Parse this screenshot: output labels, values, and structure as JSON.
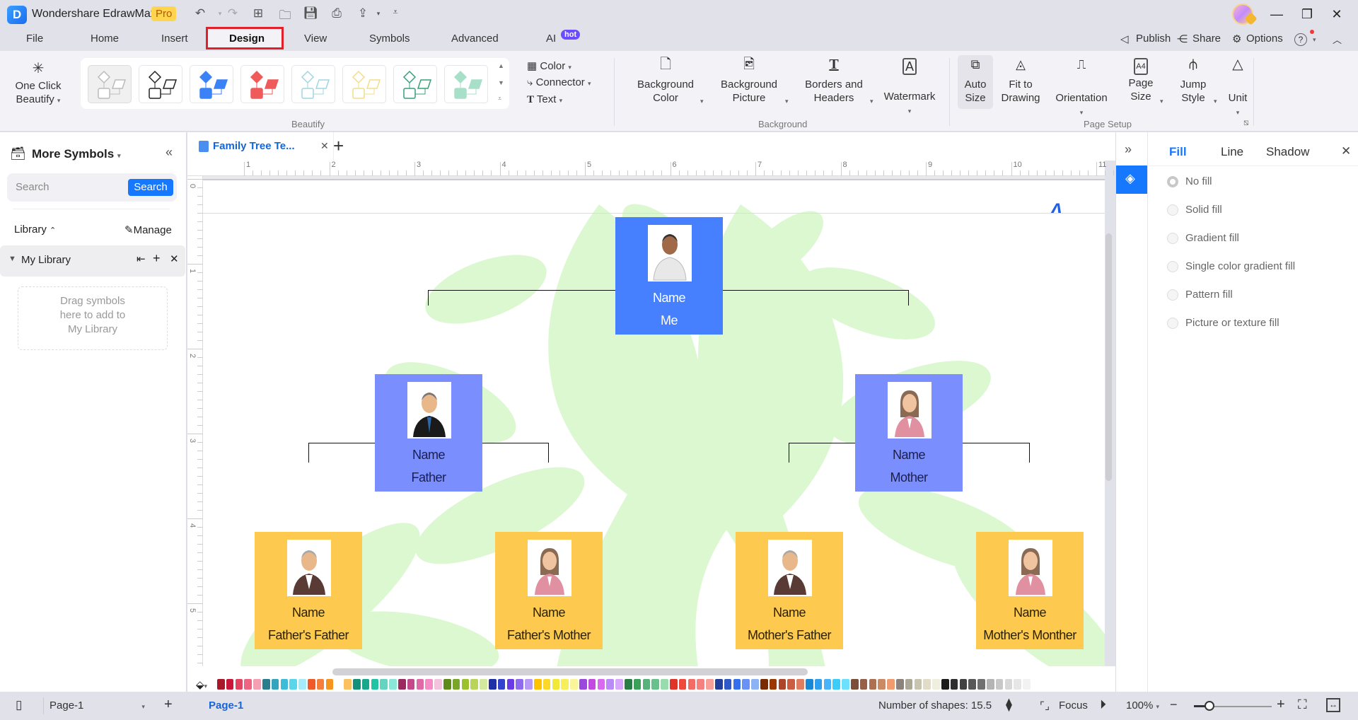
{
  "app": {
    "title": "Wondershare EdrawMax",
    "badge": "Pro",
    "window_controls": [
      "minimize",
      "restore",
      "close"
    ]
  },
  "quick_access": [
    "undo-icon",
    "redo-icon",
    "new-icon",
    "open-icon",
    "save-icon",
    "print-icon",
    "export-icon",
    "customize-icon"
  ],
  "menu": {
    "items": [
      {
        "label": "File"
      },
      {
        "label": "Home"
      },
      {
        "label": "Insert"
      },
      {
        "label": "Design",
        "active": true
      },
      {
        "label": "View"
      },
      {
        "label": "Symbols"
      },
      {
        "label": "Advanced"
      },
      {
        "label": "AI",
        "badge": "hot"
      }
    ],
    "right": {
      "publish": "Publish",
      "share": "Share",
      "options": "Options"
    }
  },
  "ribbon": {
    "beautify": {
      "one_click_label_1": "One Click",
      "one_click_label_2": "Beautify",
      "group_label": "Beautify",
      "style_count": 8,
      "style_colors": [
        "#bbbbbb",
        "#222222",
        "#3b82f6",
        "#ef5a5a",
        "#9fd6e0",
        "#f6dc8a",
        "#35a07a",
        "#a8dfc9"
      ],
      "options": {
        "color": "Color",
        "connector": "Connector",
        "text": "Text"
      }
    },
    "background": {
      "group_label": "Background",
      "bg_color_1": "Background",
      "bg_color_2": "Color",
      "bg_picture_1": "Background",
      "bg_picture_2": "Picture",
      "borders_1": "Borders and",
      "borders_2": "Headers",
      "watermark": "Watermark"
    },
    "page_setup": {
      "group_label": "Page Setup",
      "auto_size_1": "Auto",
      "auto_size_2": "Size",
      "fit_1": "Fit to",
      "fit_2": "Drawing",
      "orientation": "Orientation",
      "page_size_1": "Page",
      "page_size_2": "Size",
      "jump_1": "Jump",
      "jump_2": "Style",
      "unit": "Unit"
    }
  },
  "left_panel": {
    "title": "More Symbols",
    "search_placeholder": "Search",
    "search_button": "Search",
    "library_label": "Library",
    "manage_label": "Manage",
    "my_library": "My Library",
    "drop_hint_1": "Drag symbols",
    "drop_hint_2": "here to add to",
    "drop_hint_3": "My Library"
  },
  "document": {
    "tab_title": "Family Tree Te...",
    "ruler_h": [
      "1",
      "2",
      "3",
      "4",
      "5",
      "6",
      "7",
      "8",
      "9",
      "10",
      "11"
    ],
    "ruler_v": [
      "0",
      "1",
      "2",
      "3",
      "4",
      "5"
    ]
  },
  "family_tree": {
    "me": {
      "name": "Name",
      "role": "Me",
      "color": "#4680fe"
    },
    "parents": [
      {
        "name": "Name",
        "role": "Father",
        "color": "#7a8efe"
      },
      {
        "name": "Name",
        "role": "Mother",
        "color": "#7a8efe"
      }
    ],
    "grandparents": [
      {
        "name": "Name",
        "role": "Father's Father",
        "color": "#fec94f"
      },
      {
        "name": "Name",
        "role": "Father's Mother",
        "color": "#fec94f"
      },
      {
        "name": "Name",
        "role": "Mother's Father",
        "color": "#fec94f"
      },
      {
        "name": "Name",
        "role": "Mother's Monther",
        "color": "#fec94f"
      }
    ]
  },
  "palette": [
    "#a8172a",
    "#c9163a",
    "#e24462",
    "#ef6482",
    "#f5a0b2",
    "#2a7d8c",
    "#35a4bc",
    "#3cbcd8",
    "#5ad6ea",
    "#a6ecf8",
    "#f05a28",
    "#f57f3a",
    "#f79420",
    "#ffffff",
    "#fbc15e",
    "#159179",
    "#1aa88d",
    "#1fc4a5",
    "#62d4c0",
    "#8ae6d8",
    "#9a2a5e",
    "#c24a8a",
    "#e06aa8",
    "#f48cc6",
    "#f3c2dc",
    "#5d8a1a",
    "#78a52a",
    "#9bc12d",
    "#b8d55a",
    "#d4e8a0",
    "#1f2fa8",
    "#3442d0",
    "#6a3ae8",
    "#8f6af0",
    "#b79af5",
    "#ffc200",
    "#fbd92a",
    "#f2e838",
    "#f7ef5a",
    "#fbf59a",
    "#9b48dc",
    "#c24ae0",
    "#d86af0",
    "#b98af8",
    "#d8a6fb",
    "#2a7d45",
    "#3aa05a",
    "#58b27c",
    "#68c08a",
    "#98dcae",
    "#e03428",
    "#f04a3c",
    "#f46a64",
    "#f68080",
    "#f8a098",
    "#233f9c",
    "#2f58c8",
    "#3470ee",
    "#6a92f6",
    "#8eb2f6",
    "#7a2c00",
    "#9a3a00",
    "#ad4528",
    "#cc5c42",
    "#e07c60",
    "#1888d6",
    "#2fa0ee",
    "#4ab4f8",
    "#3cccf8",
    "#6ce0fc",
    "#7a4e38",
    "#946048",
    "#ad7050",
    "#cc8a64",
    "#f09c70",
    "#8c847c",
    "#aca898",
    "#c8c4b0",
    "#e0dcc8",
    "#f0eedc",
    "#1c1c1c",
    "#2e2e2e",
    "#414141",
    "#585858",
    "#707070",
    "#b4b4b4",
    "#c8c8c8",
    "#d8d8d8",
    "#e6e6e6",
    "#f2f2f2",
    "#ffffff"
  ],
  "right_panel": {
    "tabs": [
      "Fill",
      "Line",
      "Shadow"
    ],
    "active_tab": "Fill",
    "fill_options": [
      "No fill",
      "Solid fill",
      "Gradient fill",
      "Single color gradient fill",
      "Pattern fill",
      "Picture or texture fill"
    ],
    "selected_option": "No fill"
  },
  "status_bar": {
    "page_select": "Page-1",
    "page_tab": "Page-1",
    "shape_count": "Number of shapes: 15.5",
    "focus": "Focus",
    "zoom": "100%",
    "zoom_fraction": 0.2
  }
}
